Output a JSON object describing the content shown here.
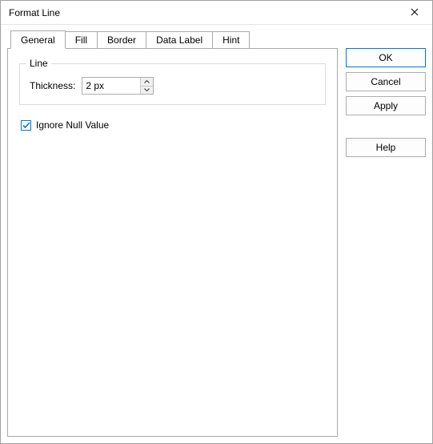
{
  "window": {
    "title": "Format Line"
  },
  "tabs": {
    "general": "General",
    "fill": "Fill",
    "border": "Border",
    "data_label": "Data Label",
    "hint": "Hint"
  },
  "group": {
    "line_title": "Line",
    "thickness_label": "Thickness:",
    "thickness_value": "2 px"
  },
  "checkbox": {
    "ignore_null_label": "Ignore Null Value",
    "ignore_null_checked": true
  },
  "buttons": {
    "ok": "OK",
    "cancel": "Cancel",
    "apply": "Apply",
    "help": "Help"
  }
}
